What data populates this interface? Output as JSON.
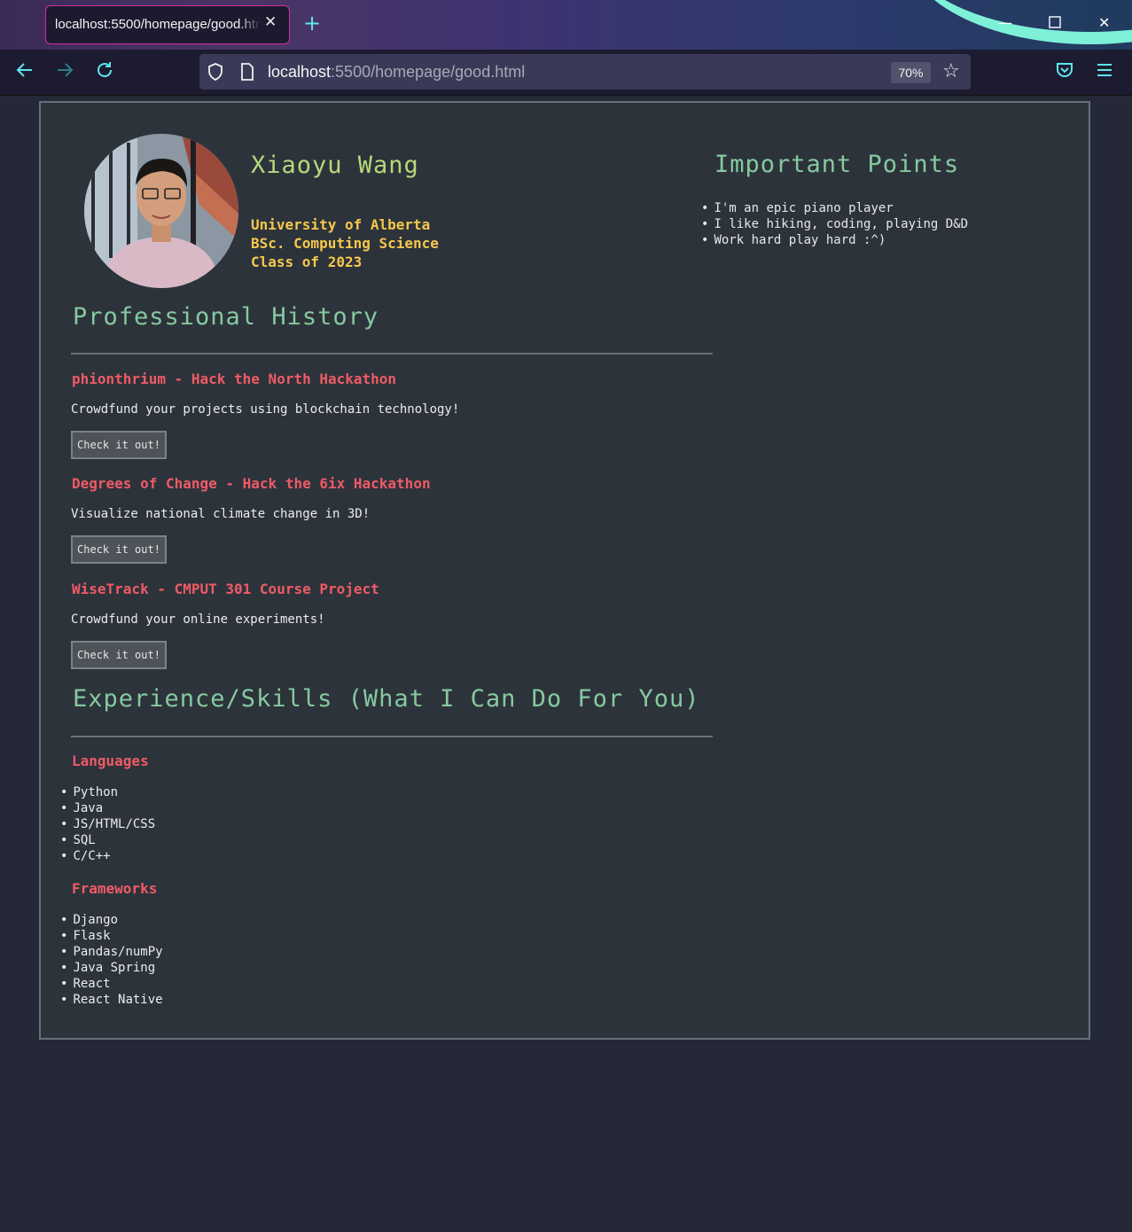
{
  "browser": {
    "tab": {
      "title": "localhost:5500/homepage/good.html",
      "close_icon": "close-icon"
    },
    "new_tab_icon": "plus-icon",
    "window_controls": {
      "minimize": "minimize-icon",
      "maximize": "maximize-icon",
      "close": "close-icon"
    },
    "nav": {
      "back": "arrow-left-icon",
      "forward": "arrow-right-icon",
      "reload": "reload-icon"
    },
    "url": {
      "host": "localhost",
      "path": ":5500/homepage/good.html"
    },
    "zoom": "70%",
    "icons": {
      "shield": "shield-icon",
      "page": "page-icon",
      "bookmark": "star-icon",
      "pocket": "pocket-icon",
      "menu": "hamburger-menu-icon"
    },
    "colors": {
      "accent": "#5ee6ef",
      "tab_border": "#d0309a"
    }
  },
  "profile": {
    "name": "Xiaoyu Wang",
    "education": [
      "University of Alberta",
      "BSc. Computing Science",
      "Class of 2023"
    ]
  },
  "important_points": {
    "title": "Important Points",
    "items": [
      "I'm an epic piano player",
      "I like hiking, coding, playing D&D",
      "Work hard play hard :^)"
    ]
  },
  "professional_history": {
    "title": "Professional History",
    "projects": [
      {
        "title": "phionthrium - Hack the North Hackathon",
        "description": "Crowdfund your projects using blockchain technology!",
        "button": "Check it out!"
      },
      {
        "title": "Degrees of Change - Hack the 6ix Hackathon",
        "description": "Visualize national climate change in 3D!",
        "button": "Check it out!"
      },
      {
        "title": "WiseTrack - CMPUT 301 Course Project",
        "description": "Crowdfund your online experiments!",
        "button": "Check it out!"
      }
    ]
  },
  "skills": {
    "title": "Experience/Skills (What I Can Do For You)",
    "languages": {
      "title": "Languages",
      "items": [
        "Python",
        "Java",
        "JS/HTML/CSS",
        "SQL",
        "C/C++"
      ]
    },
    "frameworks": {
      "title": "Frameworks",
      "items": [
        "Django",
        "Flask",
        "Pandas/numPy",
        "Java Spring",
        "React",
        "React Native"
      ]
    }
  },
  "theme": {
    "name": "#b6d97a",
    "education": "#f6c84c",
    "heading": "#86c9a0",
    "project_title": "#ef5b65",
    "panel_bg": "#2d333b",
    "page_bg": "#252836"
  }
}
